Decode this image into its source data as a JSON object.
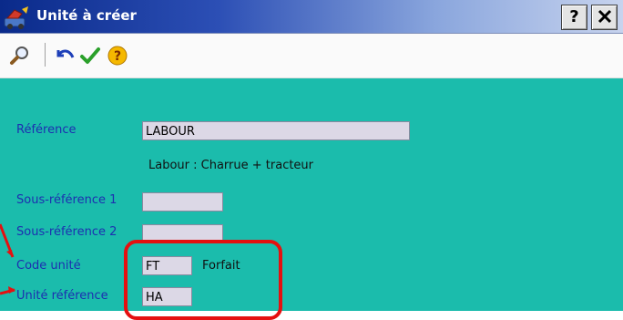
{
  "window": {
    "title": "Unité à créer",
    "help_label": "?",
    "icons": [
      "app-icon",
      "help-icon",
      "close-icon"
    ]
  },
  "toolbar": {
    "tools": [
      "search-icon",
      "undo-icon",
      "check-icon",
      "help-icon"
    ]
  },
  "form": {
    "reference": {
      "label": "Référence",
      "value": "LABOUR",
      "description": "Labour : Charrue + tracteur"
    },
    "sous_reference_1": {
      "label": "Sous-référence 1",
      "value": ""
    },
    "sous_reference_2": {
      "label": "Sous-référence 2",
      "value": ""
    },
    "code_unite": {
      "label": "Code unité",
      "value": "FT",
      "description": "Forfait"
    },
    "unite_reference": {
      "label": "Unité référence",
      "value": "HA"
    }
  },
  "colors": {
    "form_background": "#1bbcac",
    "label_text": "#1d2fb0",
    "field_background": "#dcd8e6",
    "annotation_red": "#e51010",
    "titlebar_start": "#0a2a8a"
  }
}
